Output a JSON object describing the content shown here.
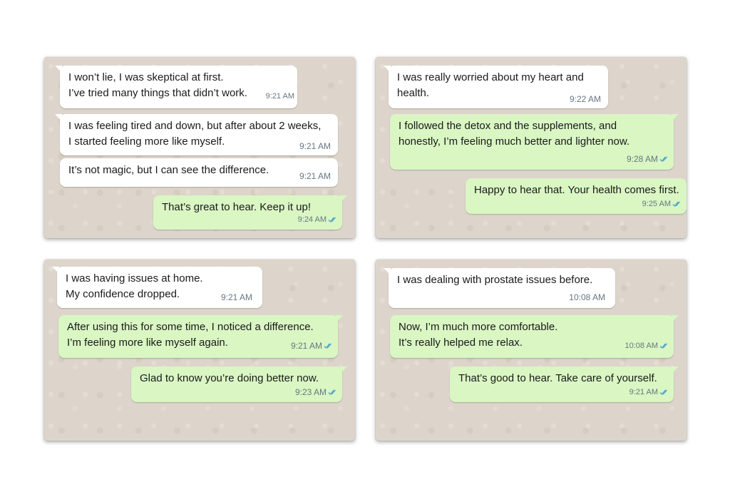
{
  "colors": {
    "card_background": "#ddd5cb",
    "incoming_bubble": "#ffffff",
    "outgoing_bubble": "#d9f6c3",
    "timestamp": "#667781",
    "read_ticks": "#53a6c7"
  },
  "panels": [
    {
      "messages": [
        {
          "dir": "in",
          "lines": [
            "I won’t lie, I was skeptical at first.",
            "I’ve tried many things that didn’t work."
          ],
          "time": "9:21 AM"
        },
        {
          "dir": "in",
          "lines": [
            "I was feeling tired and down, but after about 2 weeks,",
            "I started feeling more like myself."
          ],
          "time": "9:21 AM"
        },
        {
          "dir": "in",
          "lines": [
            "It’s not magic, but I can see the difference."
          ],
          "time": "9:21 AM"
        },
        {
          "dir": "out",
          "lines": [
            "That’s great to hear. Keep it up!"
          ],
          "time": "9:24 AM",
          "icon": "double-check-icon"
        }
      ]
    },
    {
      "messages": [
        {
          "dir": "in",
          "lines": [
            "I was really worried about my heart and",
            "health."
          ],
          "time": "9:22 AM"
        },
        {
          "dir": "out",
          "lines": [
            "I followed the detox and the supplements, and",
            "honestly, I’m feeling much better and lighter now."
          ],
          "time": "9:28 AM",
          "icon": "double-check-icon"
        },
        {
          "dir": "out",
          "lines": [
            "Happy to hear that. Your health comes first."
          ],
          "time": "9:25 AM",
          "icon": "double-check-icon"
        }
      ]
    },
    {
      "messages": [
        {
          "dir": "in",
          "lines": [
            "I was having issues at home.",
            "My confidence dropped."
          ],
          "time": "9:21 AM"
        },
        {
          "dir": "out",
          "lines": [
            "After using this for some time, I noticed a difference.",
            "I’m feeling more like myself again."
          ],
          "time": "9:21 AM",
          "icon": "double-check-icon"
        },
        {
          "dir": "out",
          "lines": [
            "Glad to know you’re doing better now."
          ],
          "time": "9:23 AM",
          "icon": "double-check-icon"
        }
      ]
    },
    {
      "messages": [
        {
          "dir": "in",
          "lines": [
            "I was dealing with prostate issues before."
          ],
          "time": "10:08 AM"
        },
        {
          "dir": "out",
          "lines": [
            "Now, I’m much more comfortable.",
            "It’s really helped me relax."
          ],
          "time": "10:08 AM",
          "icon": "double-check-icon"
        },
        {
          "dir": "out",
          "lines": [
            "That’s good to hear. Take care of yourself."
          ],
          "time": "9:21 AM",
          "icon": "double-check-icon"
        }
      ]
    }
  ]
}
